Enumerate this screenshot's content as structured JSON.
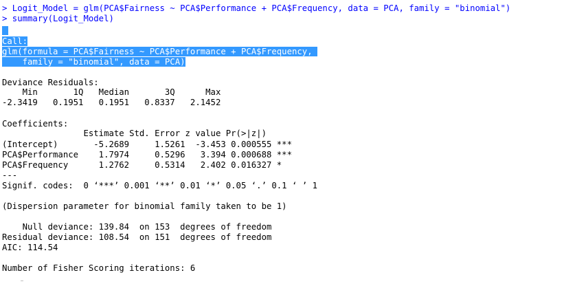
{
  "console": {
    "input_lines": [
      "> Logit_Model = glm(PCA$Fairness ~ PCA$Performance + PCA$Frequency, data = PCA, family = \"binomial\")",
      "> summary(Logit_Model)"
    ],
    "call_lines": [
      "Call:",
      "glm(formula = PCA$Fairness ~ PCA$Performance + PCA$Frequency, ",
      "    family = \"binomial\", data = PCA)"
    ],
    "deviance_residuals": {
      "title": "Deviance Residuals: ",
      "header": "    Min       1Q   Median       3Q      Max  ",
      "values": "-2.3419   0.1951   0.1951   0.8337   2.1452  "
    },
    "coefficients": {
      "title": "Coefficients:",
      "header": "                Estimate Std. Error z value Pr(>|z|)    ",
      "rows": [
        "(Intercept)       -5.2689     1.5261  -3.453 0.000555 ***",
        "PCA$Performance    1.7974     0.5296   3.394 0.000688 ***",
        "PCA$Frequency      1.2762     0.5314   2.402 0.016327 *  "
      ],
      "separator": "---",
      "signif_codes": "Signif. codes:  0 ‘***’ 0.001 ‘**’ 0.01 ‘*’ 0.05 ‘.’ 0.1 ‘ ’ 1"
    },
    "dispersion": "(Dispersion parameter for binomial family taken to be 1)",
    "null_deviance": "    Null deviance: 139.84  on 153  degrees of freedom",
    "residual_deviance": "Residual deviance: 108.54  on 151  degrees of freedom",
    "aic": "AIC: 114.54",
    "fisher": "Number of Fisher Scoring iterations: 6",
    "colors": {
      "command": "#0000ff",
      "selection": "#3399ff",
      "output": "#000000"
    }
  }
}
